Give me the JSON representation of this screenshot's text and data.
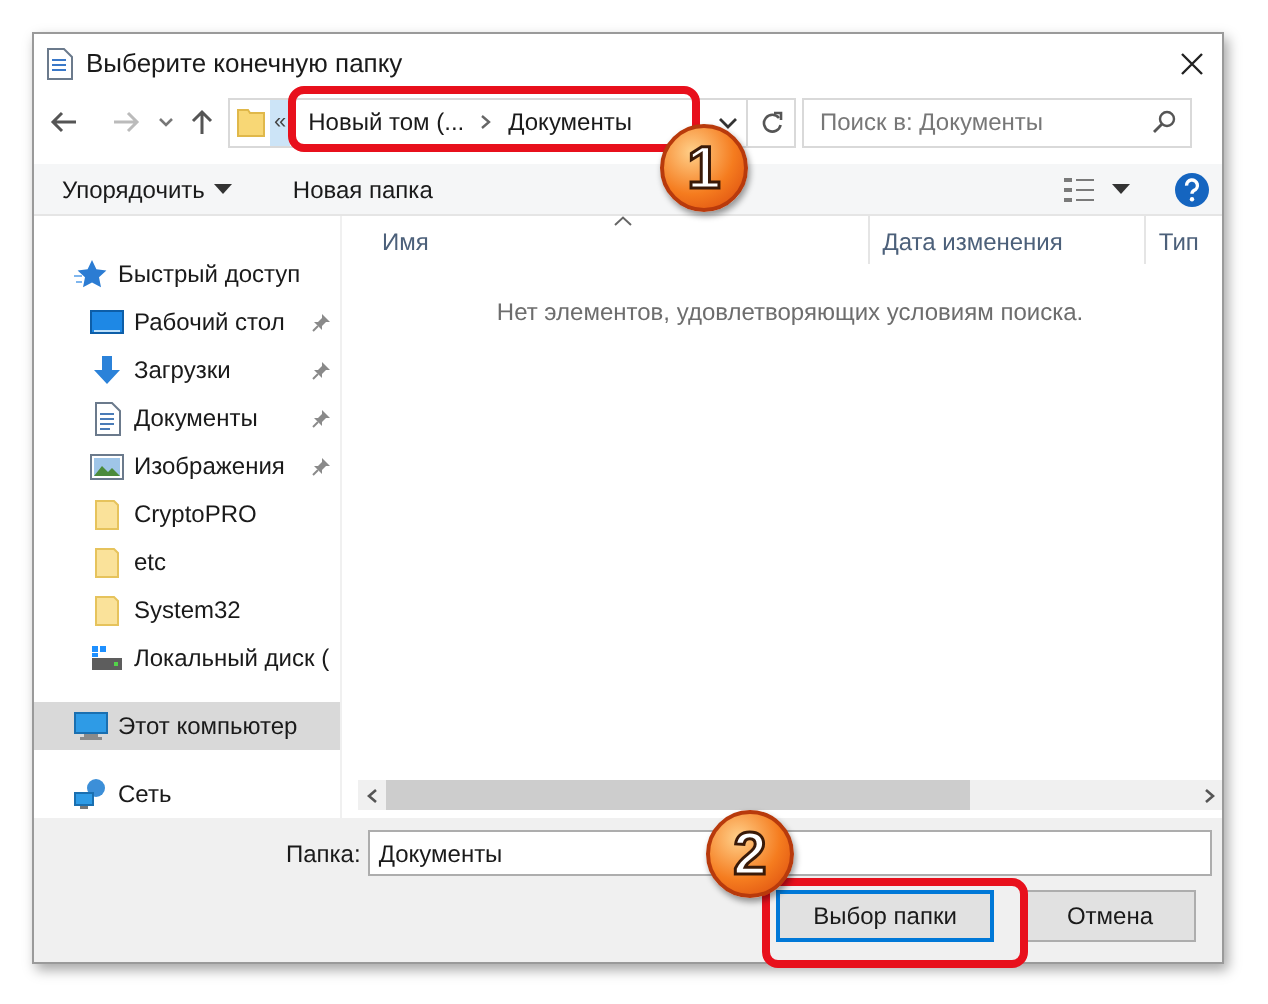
{
  "window": {
    "title": "Выберите конечную папку"
  },
  "address": {
    "overflow": "«",
    "crumbs": [
      "Новый том (...",
      "Документы"
    ],
    "callout": "1"
  },
  "search": {
    "placeholder": "Поиск в: Документы"
  },
  "toolbar": {
    "organize": "Упорядочить",
    "new_folder": "Новая папка"
  },
  "sidebar": {
    "items": [
      {
        "label": "Быстрый доступ",
        "kind": "star",
        "selected": false,
        "children": [
          {
            "label": "Рабочий стол",
            "kind": "desktop",
            "pinned": true,
            "selected": false
          },
          {
            "label": "Загрузки",
            "kind": "download",
            "pinned": true,
            "selected": false
          },
          {
            "label": "Документы",
            "kind": "document",
            "pinned": true,
            "selected": false
          },
          {
            "label": "Изображения",
            "kind": "pictures",
            "pinned": true,
            "selected": false
          },
          {
            "label": "CryptoPRO",
            "kind": "folder",
            "pinned": false,
            "selected": false
          },
          {
            "label": "etc",
            "kind": "folder",
            "pinned": false,
            "selected": false
          },
          {
            "label": "System32",
            "kind": "folder",
            "pinned": false,
            "selected": false
          },
          {
            "label": "Локальный диск (",
            "kind": "drive",
            "pinned": false,
            "selected": false
          }
        ]
      },
      {
        "label": "Этот компьютер",
        "kind": "computer",
        "selected": true
      },
      {
        "label": "Сеть",
        "kind": "network",
        "selected": false
      }
    ]
  },
  "columns": [
    {
      "label": "Имя",
      "sorted": true
    },
    {
      "label": "Дата изменения",
      "sorted": false
    },
    {
      "label": "Тип",
      "sorted": false
    }
  ],
  "empty_message": "Нет элементов, удовлетворяющих условиям поиска.",
  "folder_field": {
    "label": "Папка:",
    "value": "Документы"
  },
  "buttons": [
    {
      "label": "Выбор папки",
      "default": true,
      "callout": "2"
    },
    {
      "label": "Отмена",
      "default": false
    }
  ]
}
